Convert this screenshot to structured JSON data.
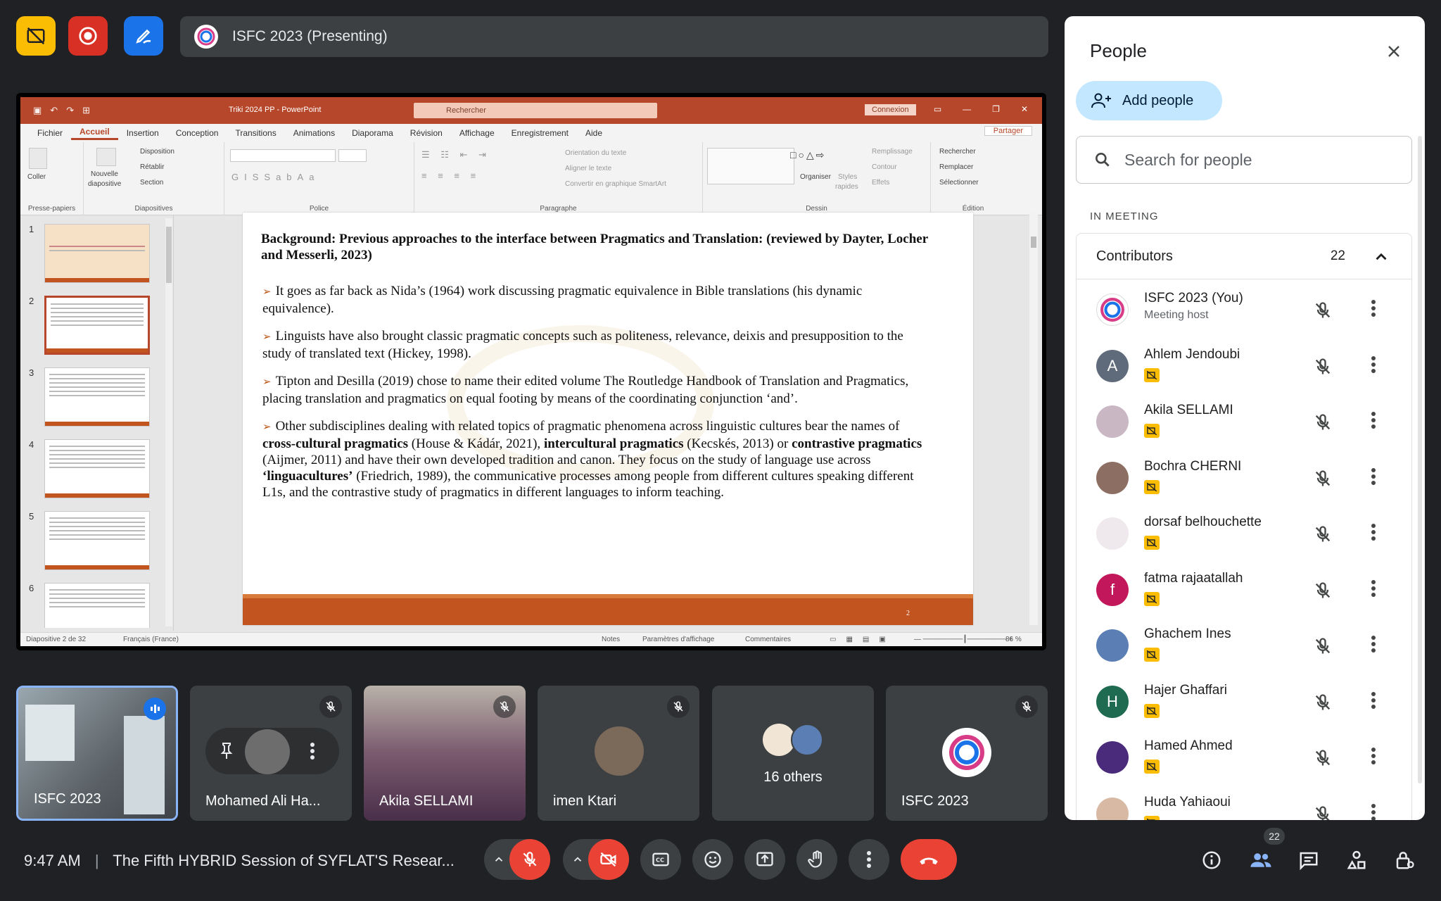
{
  "top_bar": {
    "presentation_title": "ISFC 2023 (Presenting)"
  },
  "ppt": {
    "doc_title": "Triki 2024 PP  -  PowerPoint",
    "search_placeholder": "Rechercher",
    "signin": "Connexion",
    "share": "Partager",
    "menu": [
      "Fichier",
      "Accueil",
      "Insertion",
      "Conception",
      "Transitions",
      "Animations",
      "Diaporama",
      "Révision",
      "Affichage",
      "Enregistrement",
      "Aide"
    ],
    "ribbon": {
      "coller": "Coller",
      "presse_papiers": "Presse-papiers",
      "nouvelle": "Nouvelle",
      "diapositive": "diapositive",
      "disposition": "Disposition",
      "retablir": "Rétablir",
      "section": "Section",
      "diapositives": "Diapositives",
      "police": "Police",
      "orientation": "Orientation du texte",
      "aligner": "Aligner le texte",
      "convertir": "Convertir en graphique SmartArt",
      "paragraphe": "Paragraphe",
      "organiser": "Organiser",
      "styles": "Styles",
      "rapides": "rapides",
      "remplissage": "Remplissage",
      "contour": "Contour",
      "effets": "Effets",
      "dessin": "Dessin",
      "rechercher": "Rechercher",
      "remplacer": "Remplacer",
      "selectionner": "Sélectionner",
      "edition": "Édition"
    },
    "thumb_numbers": [
      "1",
      "2",
      "3",
      "4",
      "5",
      "6"
    ],
    "slide": {
      "heading": "Background: Previous approaches to the interface between Pragmatics and Translation: (reviewed by Dayter, Locher and Messerli, 2023)",
      "b1": "It goes as far back as Nida’s (1964) work discussing pragmatic equivalence in Bible translations (his dynamic equivalence).",
      "b2": "Linguists have also brought classic pragmatic concepts such as politeness, relevance, deixis and presupposition to the study of translated text (Hickey, 1998).",
      "b3": "Tipton and Desilla (2019) chose to name their edited volume The Routledge Handbook of Translation and Pragmatics, placing translation and pragmatics on equal footing by means of the coordinating conjunction ‘and’.",
      "b4_1": "Other subdisciplines dealing with related topics of pragmatic phenomena across linguistic cultures bear the names of ",
      "b4_2": "cross-cultural pragmatics",
      "b4_3": " (House & Kádár, 2021), ",
      "b4_4": "intercultural pragmatics",
      "b4_5": " (Kecskés, 2013) or ",
      "b4_6": "contrastive pragmatics",
      "b4_7": " (Aijmer, 2011) and have their own developed tradition and canon. They focus on the study of language use across ",
      "b4_8": "‘linguacultures’",
      "b4_9": " (Friedrich, 1989), the communicative processes among people from different cultures speaking different L1s, and the contrastive study of pragmatics in different languages to inform teaching.",
      "page": "2"
    },
    "status": {
      "slide_of": "Diapositive 2 de 32",
      "lang": "Français (France)",
      "notes": "Notes",
      "params": "Paramètres d'affichage",
      "comments": "Commentaires",
      "zoom": "86 %"
    }
  },
  "tiles": [
    {
      "name": "ISFC 2023"
    },
    {
      "name": "Mohamed Ali Ha..."
    },
    {
      "name": "Akila SELLAMI"
    },
    {
      "name": "imen Ktari"
    },
    {
      "name": "16 others"
    },
    {
      "name": "ISFC 2023"
    }
  ],
  "bottom_bar": {
    "time": "9:47 AM",
    "separator": "|",
    "meeting_title": "The Fifth HYBRID Session of SYFLAT'S Resear...",
    "people_count": "22"
  },
  "people_panel": {
    "title": "People",
    "add_people": "Add people",
    "search_placeholder": "Search for people",
    "in_meeting": "IN MEETING",
    "contributors_label": "Contributors",
    "contributors_count": "22",
    "participants": [
      {
        "name": "ISFC 2023 (You)",
        "sub": "Meeting host",
        "initial": "",
        "color": "#ffffff"
      },
      {
        "name": "Ahlem Jendoubi",
        "initial": "A",
        "color": "#5f6b7a"
      },
      {
        "name": "Akila SELLAMI",
        "initial": "",
        "color": "#c9b7c4"
      },
      {
        "name": "Bochra CHERNI",
        "initial": "",
        "color": "#8d6e63"
      },
      {
        "name": "dorsaf belhouchette",
        "initial": "",
        "color": "#efe8ec"
      },
      {
        "name": "fatma rajaatallah",
        "initial": "f",
        "color": "#c2185b"
      },
      {
        "name": "Ghachem Ines",
        "initial": "",
        "color": "#5b7fb5"
      },
      {
        "name": "Hajer Ghaffari",
        "initial": "H",
        "color": "#1e6b52"
      },
      {
        "name": "Hamed Ahmed",
        "initial": "",
        "color": "#4a2a7a"
      },
      {
        "name": "Huda Yahiaoui",
        "initial": "",
        "color": "#d7b9a4"
      }
    ]
  },
  "colors": {
    "bg": "#202124",
    "ppt_accent": "#b7472a",
    "end_call": "#ea4335",
    "add_people_bg": "#c2e7ff"
  },
  "icons": [
    "no-captions-icon",
    "record-icon",
    "pen-icon",
    "mic-off-icon",
    "video-off-icon",
    "cc-icon",
    "emoji-icon",
    "present-icon",
    "hand-icon",
    "more-icon",
    "end-call-icon",
    "info-icon",
    "people-icon",
    "chat-icon",
    "activities-icon",
    "lock-icon",
    "close-icon",
    "search-icon",
    "chevron-up-icon"
  ]
}
